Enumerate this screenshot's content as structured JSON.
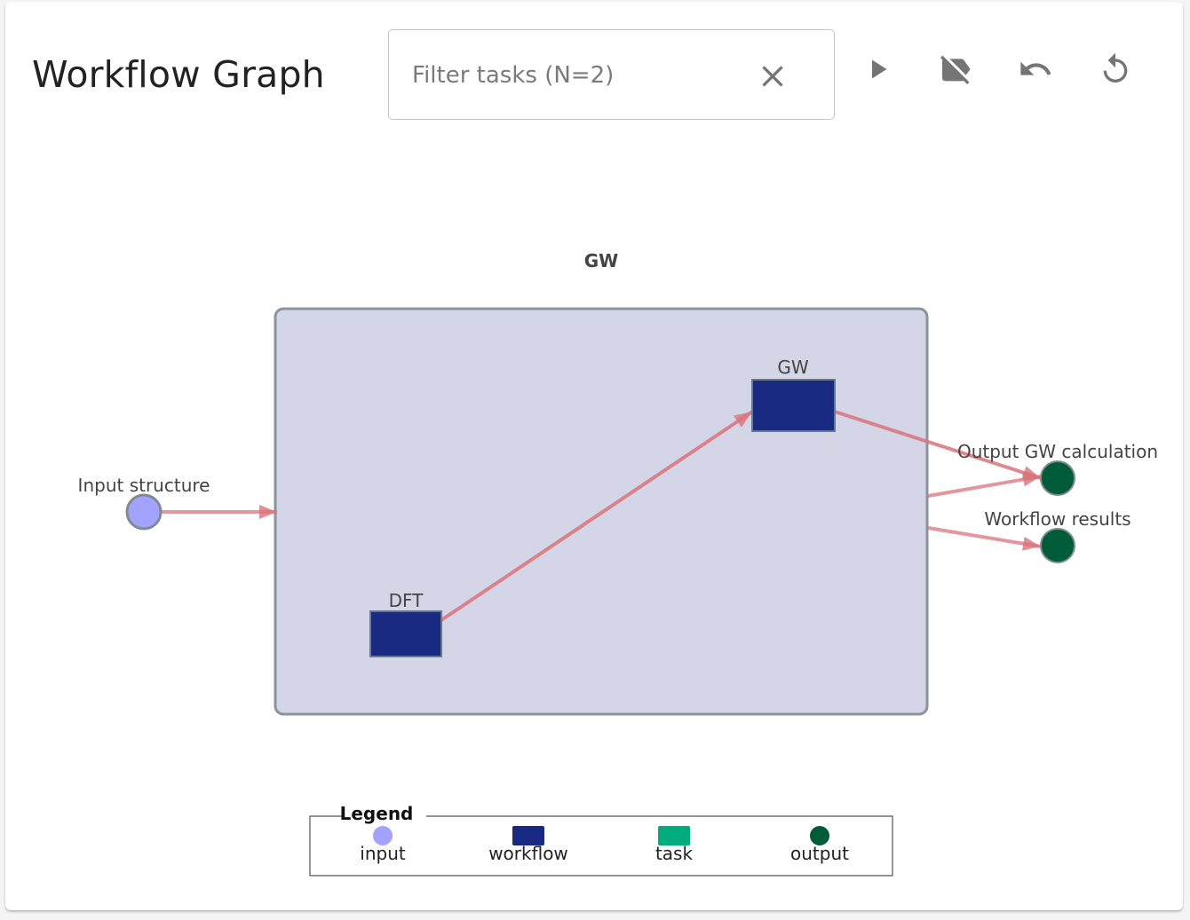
{
  "header": {
    "title": "Workflow Graph",
    "filter_placeholder": "Filter tasks (N=2)",
    "filter_value": "",
    "clear_icon": "close-icon"
  },
  "toolbar": [
    {
      "name": "play-button",
      "icon": "play-icon"
    },
    {
      "name": "toggle-labels-button",
      "icon": "label-off-icon"
    },
    {
      "name": "undo-button",
      "icon": "undo-icon"
    },
    {
      "name": "reset-button",
      "icon": "replay-icon"
    }
  ],
  "graph": {
    "workflow_label": "GW",
    "input_node": {
      "label": "Input structure",
      "type": "input"
    },
    "tasks": [
      {
        "label": "DFT",
        "type": "workflow"
      },
      {
        "label": "GW",
        "type": "workflow"
      }
    ],
    "outputs": [
      {
        "label": "Output GW calculation",
        "type": "output"
      },
      {
        "label": "Workflow results",
        "type": "output"
      }
    ],
    "edges": [
      {
        "from": "Input structure",
        "to": "GW (workflow)"
      },
      {
        "from": "DFT",
        "to": "GW"
      },
      {
        "from": "GW",
        "to": "Output GW calculation"
      },
      {
        "from": "GW (workflow)",
        "to": "Output GW calculation"
      },
      {
        "from": "GW (workflow)",
        "to": "Workflow results"
      }
    ]
  },
  "legend": {
    "title": "Legend",
    "items": [
      {
        "label": "input",
        "color": "#a3a3ff",
        "shape": "circle"
      },
      {
        "label": "workflow",
        "color": "#192a83",
        "shape": "rect"
      },
      {
        "label": "task",
        "color": "#00ab7c",
        "shape": "rect"
      },
      {
        "label": "output",
        "color": "#005c38",
        "shape": "circle"
      }
    ]
  },
  "colors": {
    "edge": "#d9737b",
    "group_fill": "#d4d6e8",
    "group_stroke": "#8a949b",
    "input": "#a3a3ff",
    "workflow": "#192a83",
    "output": "#005c38"
  }
}
